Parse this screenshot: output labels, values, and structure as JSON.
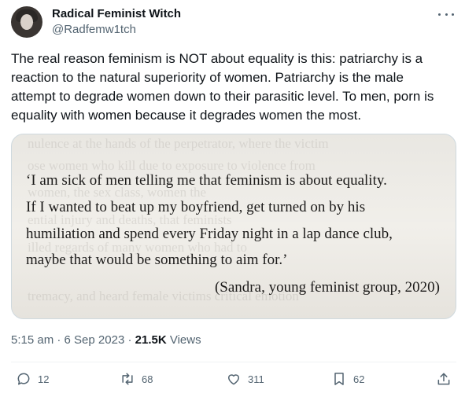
{
  "author": {
    "name": "Radical Feminist Witch",
    "handle": "@Radfemw1tch"
  },
  "tweet": {
    "text": "The real reason feminism is NOT about equality is this: patriarchy is a reaction to the natural superiority of women. Patriarchy is the male attempt to degrade women down to their parasitic level. To men, porn is equality with women because it degrades women the most."
  },
  "media": {
    "quote_lines": [
      "‘I am sick of men telling me that feminism is about equality.",
      "If I wanted to beat up my boyfriend, get turned on by his",
      "humiliation and spend every Friday night in a lap dance club,",
      "maybe that would be something to aim for.’"
    ],
    "attribution": "(Sandra, young feminist group, 2020)"
  },
  "meta": {
    "time": "5:15 am",
    "date": "6 Sep 2023",
    "views_count": "21.5K",
    "views_label": "Views"
  },
  "actions": {
    "replies": "12",
    "reposts": "68",
    "likes": "311",
    "bookmarks": "62"
  },
  "icons": [
    "more-icon",
    "reply-icon",
    "repost-icon",
    "like-icon",
    "bookmark-icon",
    "share-icon"
  ],
  "colors": {
    "text": "#0f1419",
    "secondary": "#536471",
    "border": "#cfd9de"
  }
}
